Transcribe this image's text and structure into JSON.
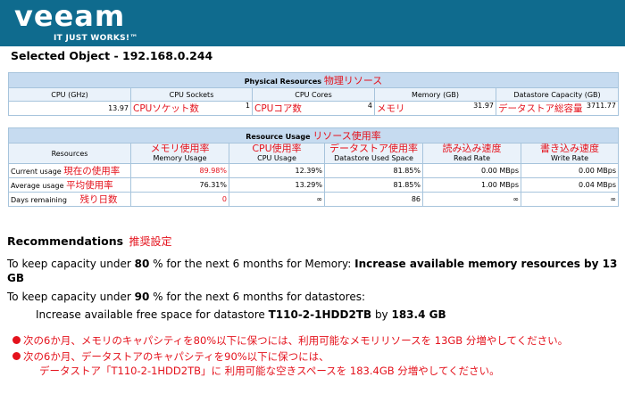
{
  "logo": {
    "word": "veeam",
    "tagline": "IT JUST WORKS!™"
  },
  "selected_object": "Selected Object - 192.168.0.244",
  "physical": {
    "title": "Physical Resources",
    "title_jp": "物理リソース",
    "headers": [
      "CPU (GHz)",
      "CPU Sockets",
      "CPU Cores",
      "Memory (GB)",
      "Datastore Capacity (GB)"
    ],
    "row": {
      "cpu_ghz": "13.97",
      "sockets_jp": "CPUソケット数",
      "sockets": "1",
      "cores_jp": "CPUコア数",
      "cores": "4",
      "memory_jp": "メモリ",
      "memory": "31.97",
      "datastore_jp": "データストア総容量",
      "datastore": "3711.77"
    }
  },
  "usage": {
    "title": "Resource Usage",
    "title_jp": "リソース使用率",
    "headers": {
      "resources": "Resources",
      "memory_jp": "メモリ使用率",
      "memory": "Memory Usage",
      "cpu_jp": "CPU使用率",
      "cpu": "CPU Usage",
      "ds_jp": "データストア使用率",
      "ds": "Datastore Used Space",
      "read_jp": "読み込み速度",
      "read": "Read Rate",
      "write_jp": "書き込み速度",
      "write": "Write Rate"
    },
    "rows": [
      {
        "label": "Current usage",
        "label_jp": "現在の使用率",
        "memory": "89.98%",
        "cpu": "12.39%",
        "ds": "81.85%",
        "read": "0.00 MBps",
        "write": "0.00 MBps"
      },
      {
        "label": "Average usage",
        "label_jp": "平均使用率",
        "memory": "76.31%",
        "cpu": "13.29%",
        "ds": "81.85%",
        "read": "1.00 MBps",
        "write": "0.04 MBps"
      },
      {
        "label": "Days remaining",
        "label_jp": "残り日数",
        "memory": "0",
        "cpu": "∞",
        "ds": "86",
        "read": "∞",
        "write": "∞"
      }
    ]
  },
  "recommendations": {
    "title": "Recommendations",
    "title_jp": "推奨設定",
    "line1_a": "To keep capacity under ",
    "line1_pct": "80",
    "line1_b": " % for the next 6 months for Memory: ",
    "line1_action": "Increase available memory resources by 13 GB",
    "line2_a": "To keep capacity under ",
    "line2_pct": "90",
    "line2_b": " % for the next 6 months for datastores:",
    "line3_a": "Increase available free space for datastore ",
    "line3_ds": "T110-2-1HDD2TB",
    "line3_b": " by ",
    "line3_amt": "183.4 GB",
    "note1": "次の6か月、メモリのキャパシティを80%以下に保つには、利用可能なメモリリソースを 13GB 分増やしてください。",
    "note2": "次の6か月、データストアのキャパシティを90%以下に保つには、",
    "note3": "データストア「T110-2-1HDD2TB」に 利用可能な空きスペースを 183.4GB 分増やしてください。"
  }
}
